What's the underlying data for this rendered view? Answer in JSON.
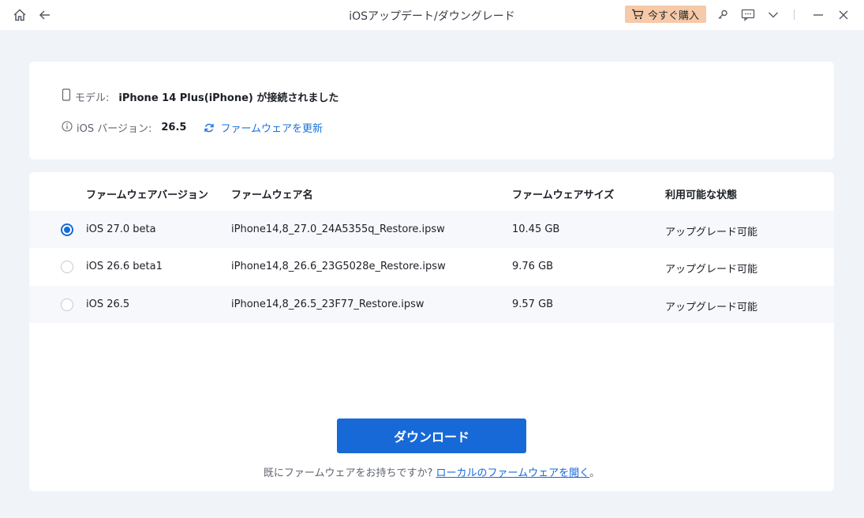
{
  "window": {
    "title": "iOSアップデート/ダウングレード",
    "buy_label": "今すぐ購入",
    "icons": [
      "home-icon",
      "back-arrow-icon",
      "cart-icon",
      "key-icon",
      "feedback-icon",
      "chevron-down-icon",
      "minimize-icon",
      "close-icon"
    ]
  },
  "device": {
    "model_label": "モデル:",
    "model_value": "iPhone 14 Plus(iPhone) が接続されました",
    "version_label": "iOS バージョン:",
    "version_value": "26.5",
    "refresh_label": "ファームウェアを更新"
  },
  "table": {
    "headers": [
      "ファームウェアバージョン",
      "ファームウェア名",
      "ファームウェアサイズ",
      "利用可能な状態"
    ],
    "rows": [
      {
        "version": "iOS 27.0 beta",
        "name": "iPhone14,8_27.0_24A5355q_Restore.ipsw",
        "size": "10.45 GB",
        "status": "アップグレード可能",
        "selected": true
      },
      {
        "version": "iOS 26.6 beta1",
        "name": "iPhone14,8_26.6_23G5028e_Restore.ipsw",
        "size": "9.76 GB",
        "status": "アップグレード可能",
        "selected": false
      },
      {
        "version": "iOS 26.5",
        "name": "iPhone14,8_26.5_23F77_Restore.ipsw",
        "size": "9.57 GB",
        "status": "アップグレード可能",
        "selected": false
      }
    ]
  },
  "actions": {
    "download_label": "ダウンロード",
    "note_prefix": "既にファームウェアをお持ちですか?",
    "note_link": "ローカルのファームウェアを開く",
    "note_suffix": "。"
  },
  "colors": {
    "accent": "#1769d8",
    "buy_bg": "#f6c9a9",
    "background": "#f0f3f8"
  }
}
